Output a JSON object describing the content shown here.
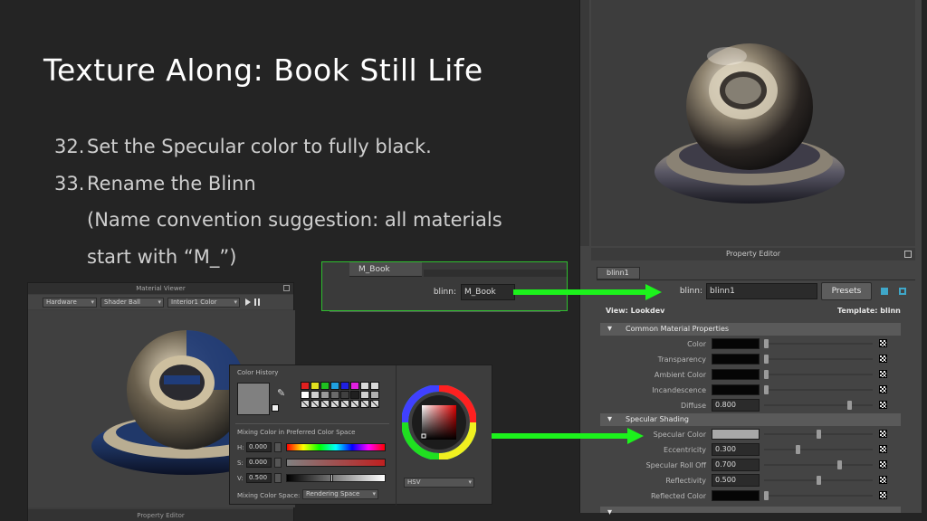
{
  "slide": {
    "title": "Texture Along: Book Still Life",
    "steps": [
      {
        "num": "32.",
        "text": "Set the Specular color to fully black."
      },
      {
        "num": "33.",
        "text": "Rename the Blinn"
      }
    ],
    "sub_lines": [
      "(Name convention suggestion: all materials",
      "start with “M_”)"
    ]
  },
  "middle_strip": {
    "tab": "M_Book",
    "field_label": "blinn:",
    "field_value": "M_Book"
  },
  "property_editor": {
    "title": "Property Editor",
    "tab": "blinn1",
    "name_label": "blinn:",
    "name_value": "blinn1",
    "presets_label": "Presets",
    "view_text": "View: Lookdev",
    "template_text": "Template: blinn",
    "common_section": "Common Material Properties",
    "common_rows": [
      {
        "label": "Color",
        "value": "",
        "swatch": "#050505",
        "slider": 0.0
      },
      {
        "label": "Transparency",
        "value": "",
        "swatch": "#050505",
        "slider": 0.0
      },
      {
        "label": "Ambient Color",
        "value": "",
        "swatch": "#050505",
        "slider": 0.0
      },
      {
        "label": "Incandescence",
        "value": "",
        "swatch": "#050505",
        "slider": 0.0
      },
      {
        "label": "Diffuse",
        "value": "0.800",
        "swatch": "",
        "slider": 0.8
      }
    ],
    "specular_section": "Specular Shading",
    "specular_rows": [
      {
        "label": "Specular Color",
        "value": "",
        "swatch": "#a8a8a8",
        "slider": 0.5
      },
      {
        "label": "Eccentricity",
        "value": "0.300",
        "swatch": "",
        "slider": 0.3
      },
      {
        "label": "Specular Roll Off",
        "value": "0.700",
        "swatch": "",
        "slider": 0.7
      },
      {
        "label": "Reflectivity",
        "value": "0.500",
        "swatch": "",
        "slider": 0.5
      },
      {
        "label": "Reflected Color",
        "value": "",
        "swatch": "#050505",
        "slider": 0.0
      }
    ]
  },
  "material_viewer": {
    "title": "Material Viewer",
    "renderer": "Hardware",
    "shape": "Shader Ball",
    "environment": "Interior1 Color",
    "bottom_title": "Property Editor"
  },
  "color_chooser": {
    "history_label": "Color History",
    "mixing_label": "Mixing Color in Preferred Color Space",
    "h_label": "H:",
    "h_value": "0.000",
    "s_label": "S:",
    "s_value": "0.000",
    "v_label": "V:",
    "v_value": "0.500",
    "space_label": "Mixing Color Space:",
    "space_value": "Rendering Space",
    "mode_value": "HSV",
    "history_colors": [
      "#e02020",
      "#e0e020",
      "#20c020",
      "#20a0e0",
      "#2020e0",
      "#e020e0"
    ],
    "current_color": "#808080"
  },
  "colors": {
    "accent_arrow": "#1cf21c"
  }
}
